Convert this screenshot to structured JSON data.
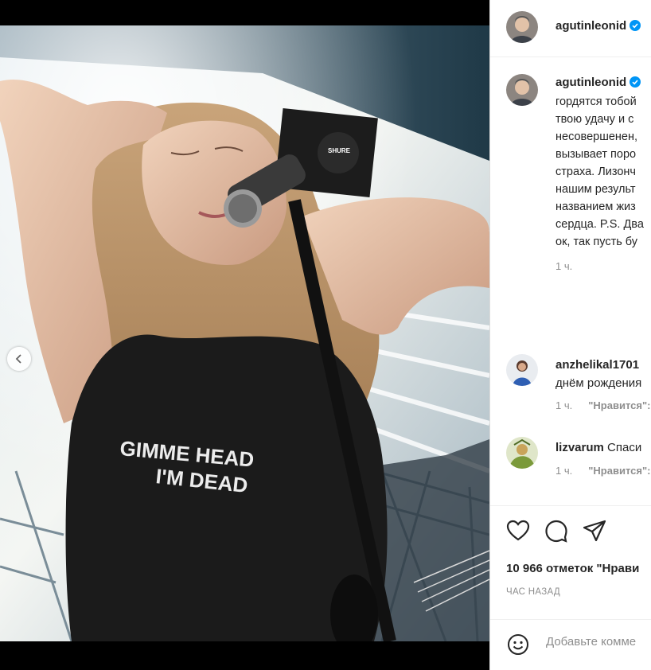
{
  "post": {
    "carousel": {
      "active_index": 1,
      "count": 2,
      "prev_icon": "chevron-left-icon"
    },
    "photo": {
      "tshirt_lines": [
        "GIMME HEAD",
        "I'M DEAD"
      ],
      "mic_brand": "SHURE"
    }
  },
  "header": {
    "username": "agutinleonid",
    "verified_icon": "verified-badge-icon"
  },
  "caption": {
    "username": "agutinleonid",
    "lines": [
      "гордятся тобой",
      "твою удачу и с",
      "несовершенен,",
      "вызывает поро",
      "страха. Лизонч",
      "нашим результ",
      "названием жиз",
      "сердца. P.S. Два",
      "ок, так пусть бу"
    ],
    "time": "1 ч."
  },
  "comments": [
    {
      "username": "anzhelikal1701",
      "text_tail": "",
      "second_line": "днём рождения",
      "time": "1 ч.",
      "like_label": "\"Нравится\":"
    },
    {
      "username": "lizvarum",
      "text_tail": "Спаси",
      "time": "1 ч.",
      "like_label": "\"Нравится\":"
    }
  ],
  "actions": {
    "like_icon": "heart-icon",
    "comment_icon": "comment-icon",
    "share_icon": "paper-plane-icon"
  },
  "likes": "10 966 отметок \"Нрави",
  "post_time": "ЧАС НАЗАД",
  "add_comment": {
    "emoji_icon": "smiley-icon",
    "placeholder": "Добавьте комме"
  },
  "colors": {
    "accent": "#0095f6",
    "text": "#262626",
    "secondary": "#8e8e8e"
  }
}
